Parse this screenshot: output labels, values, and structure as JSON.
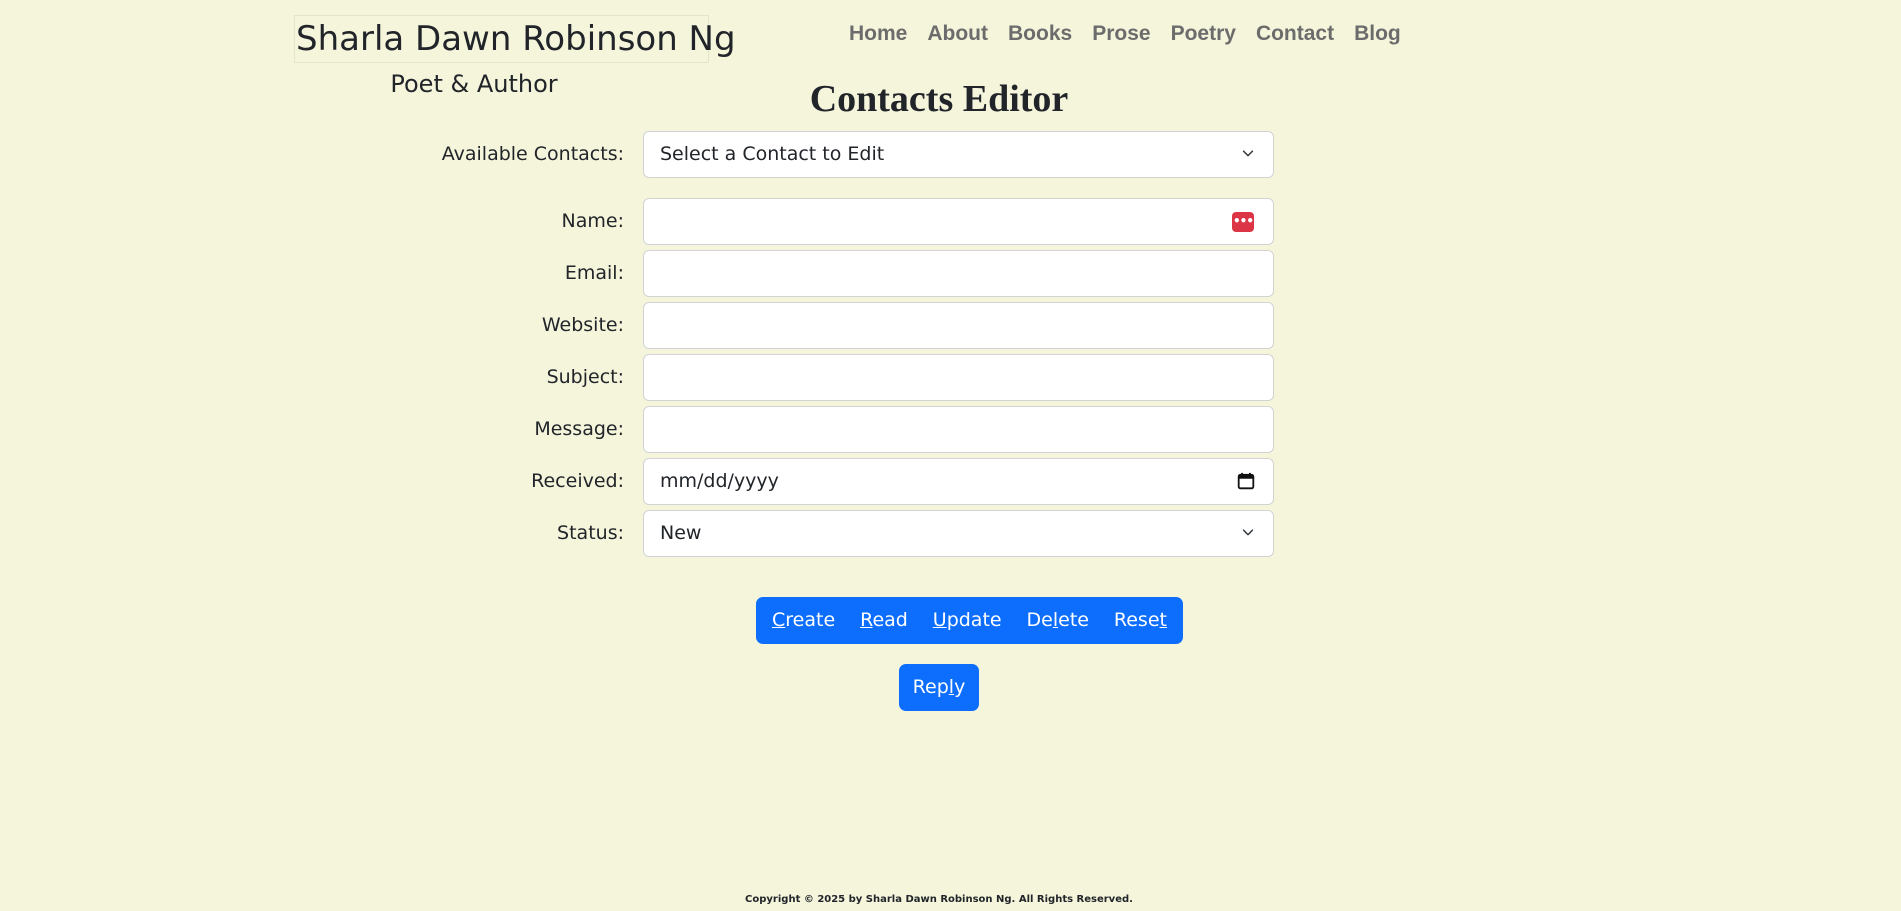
{
  "header": {
    "brand": "Sharla Dawn Robinson Ng",
    "tagline": "Poet & Author",
    "nav": [
      "Home",
      "About",
      "Books",
      "Prose",
      "Poetry",
      "Contact",
      "Blog"
    ]
  },
  "page": {
    "title": "Contacts Editor"
  },
  "form": {
    "available_contacts": {
      "label": "Available Contacts:",
      "selected": "Select a Contact to Edit"
    },
    "name": {
      "label": "Name:",
      "value": ""
    },
    "email": {
      "label": "Email:",
      "value": ""
    },
    "website": {
      "label": "Website:",
      "value": ""
    },
    "subject": {
      "label": "Subject:",
      "value": ""
    },
    "message": {
      "label": "Message:",
      "value": ""
    },
    "received": {
      "label": "Received:",
      "placeholder": "mm/dd/yyyy"
    },
    "status": {
      "label": "Status:",
      "selected": "New"
    }
  },
  "actions": {
    "buttons": [
      {
        "key": "C",
        "rest": "reate"
      },
      {
        "key": "R",
        "rest": "ead"
      },
      {
        "key": "U",
        "rest": "pdate"
      },
      {
        "pre": "De",
        "key": "l",
        "rest": "ete"
      },
      {
        "pre": "Rese",
        "key": "t",
        "rest": ""
      }
    ],
    "reply": {
      "pre": "Rep",
      "key": "l",
      "rest": "y"
    }
  },
  "footer": {
    "copyright": "Copyright © 2025 by Sharla Dawn Robinson Ng. All Rights Reserved."
  },
  "icons": {
    "select_chevron": "chevron-down-icon",
    "password_manager": "password-manager-icon",
    "calendar": "calendar-icon"
  },
  "colors": {
    "background": "#f5f5dc",
    "primary": "#0d6efd",
    "nav_text": "#6c6c6c",
    "key_icon": "#dc3545"
  }
}
